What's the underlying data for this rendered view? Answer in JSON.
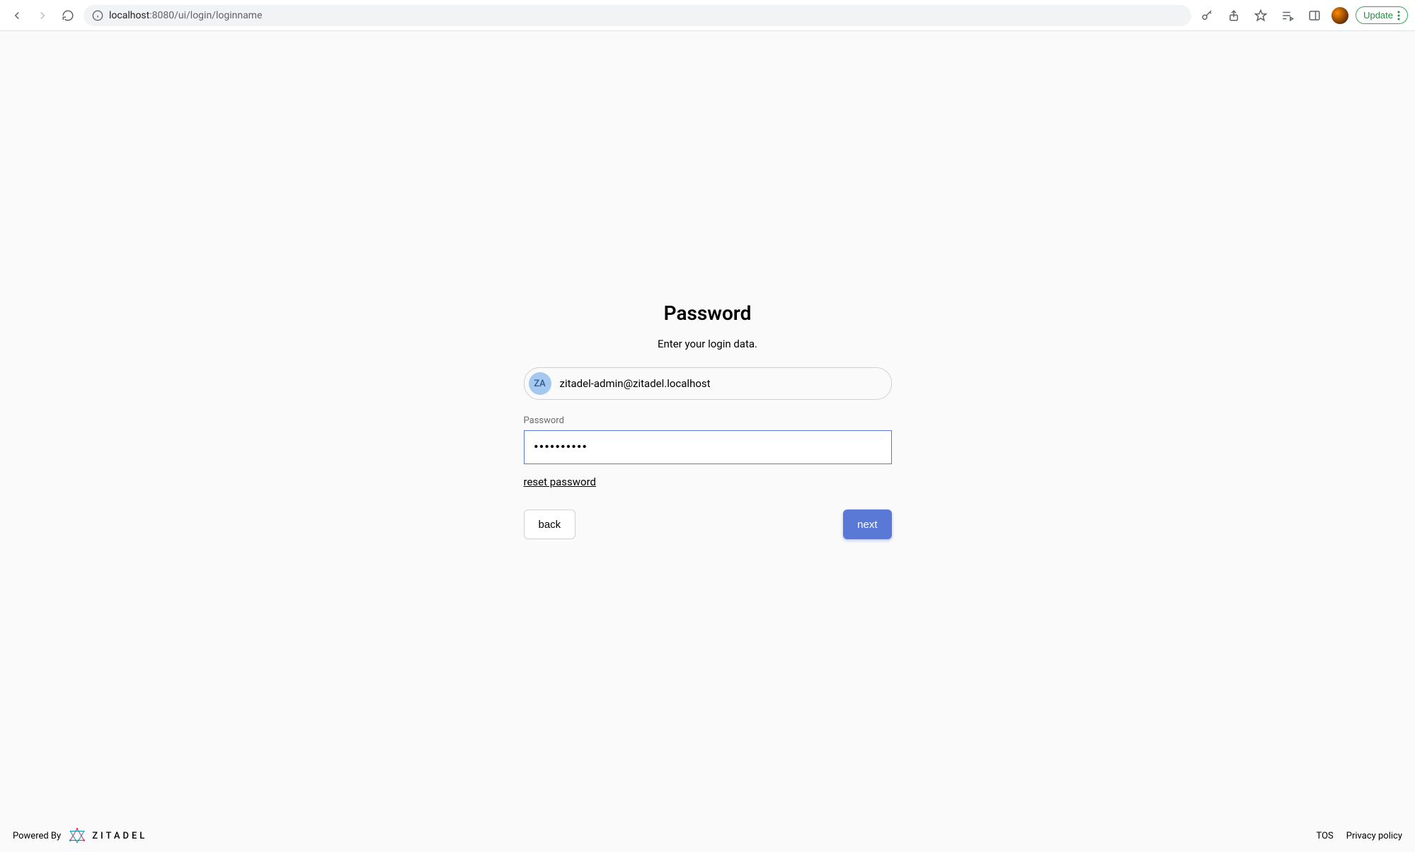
{
  "browser": {
    "url_host": "localhost",
    "url_port_path": ":8080/ui/login/loginname",
    "update_label": "Update"
  },
  "login": {
    "title": "Password",
    "subtitle": "Enter your login data.",
    "user_initials": "ZA",
    "user_email": "zitadel-admin@zitadel.localhost",
    "password_label": "Password",
    "password_value": "••••••••••",
    "reset_link": "reset password",
    "back_label": "back",
    "next_label": "next"
  },
  "footer": {
    "powered_by": "Powered By",
    "brand": "ZITADEL",
    "tos": "TOS",
    "privacy": "Privacy policy"
  }
}
